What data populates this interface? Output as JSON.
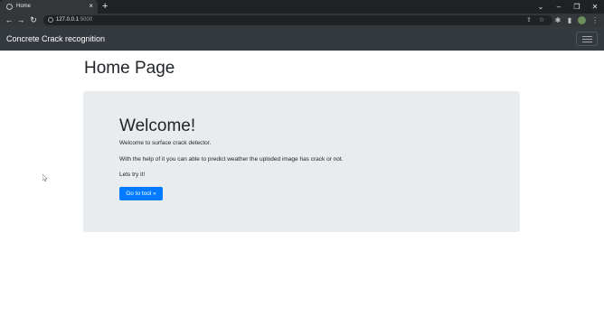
{
  "browser": {
    "tab_title": "Home",
    "tab_close": "×",
    "new_tab": "+",
    "url_host": "127.0.0.1",
    "url_port": ":5000",
    "win_controls": [
      "⌄",
      "–",
      "❐",
      "✕"
    ],
    "nav": [
      "←",
      "→",
      "↻"
    ]
  },
  "navbar": {
    "brand": "Concrete Crack recognition"
  },
  "page": {
    "title": "Home Page"
  },
  "jumbotron": {
    "heading": "Welcome!",
    "line1": "Welcome to surface crack detector.",
    "line2": "With the help of it you can able to predict weather the uploded image has crack or not.",
    "line3": "Lets try it!",
    "button": "Go to tool »"
  },
  "colors": {
    "navbar_bg": "#343a40",
    "jumbotron_bg": "#e9ecef",
    "primary": "#007bff"
  }
}
